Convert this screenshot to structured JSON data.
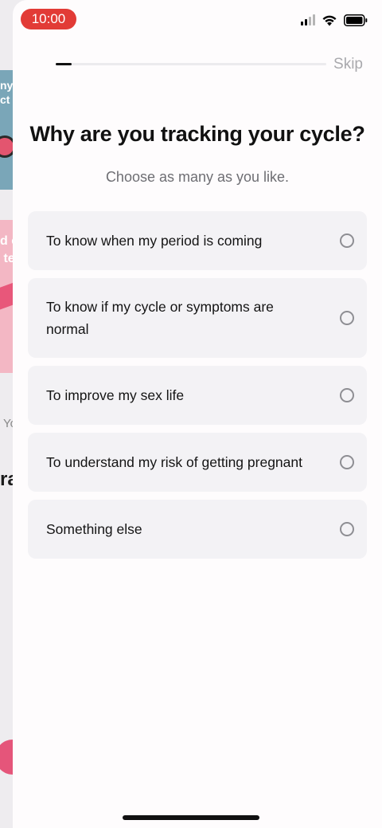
{
  "status_bar": {
    "time": "10:00",
    "time_pill_color": "#e23b36"
  },
  "background_page": {
    "blue_card_text": "ny\nct",
    "pink_card_text": "d c\n te",
    "small_text": "Yo",
    "bold_text": "ra"
  },
  "onboarding": {
    "progress": 0.06,
    "skip_label": "Skip",
    "title": "Why are you tracking your cycle?",
    "subtitle": "Choose as many as you like.",
    "options": [
      {
        "label": "To know when my period is coming",
        "selected": false
      },
      {
        "label": "To know if my cycle or symptoms are normal",
        "selected": false
      },
      {
        "label": "To improve my sex life",
        "selected": false
      },
      {
        "label": "To understand my risk of getting pregnant",
        "selected": false
      },
      {
        "label": "Something else",
        "selected": false
      }
    ]
  },
  "icons": {
    "signal": "signal-icon",
    "wifi": "wifi-icon",
    "battery": "battery-icon",
    "radio": "radio-unchecked-icon"
  }
}
